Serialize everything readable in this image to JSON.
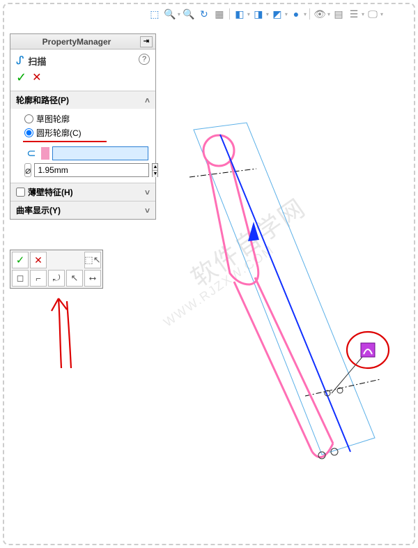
{
  "top_toolbar": {
    "icons": [
      "magnify",
      "zoom-fit",
      "zoom-area",
      "rotate",
      "section",
      "cube",
      "cube2",
      "cube3",
      "sphere",
      "eye",
      "palette",
      "layers",
      "monitor"
    ]
  },
  "pm": {
    "title": "PropertyManager",
    "feature_name": "扫描",
    "help_label": "?",
    "ok_label": "✓",
    "cancel_label": "✕",
    "section1": {
      "title": "轮廓和路径(P)",
      "radio_sketch": "草图轮廓",
      "radio_circular": "圆形轮廓(C)",
      "selected": "circular",
      "diameter": "1.95mm"
    },
    "section2": {
      "checkbox_thin": "薄壁特征(H)",
      "checked": false
    },
    "section3": {
      "title": "曲率显示(Y)"
    }
  },
  "context_toolbar": {
    "row1": [
      "ok",
      "cancel",
      "",
      "",
      "select"
    ],
    "row2": [
      "box",
      "line",
      "tangent",
      "cursor",
      "pointer"
    ]
  },
  "watermark": {
    "main": "软件自学网",
    "sub": "WWW.RJZXW.COM"
  },
  "chart_data": null
}
